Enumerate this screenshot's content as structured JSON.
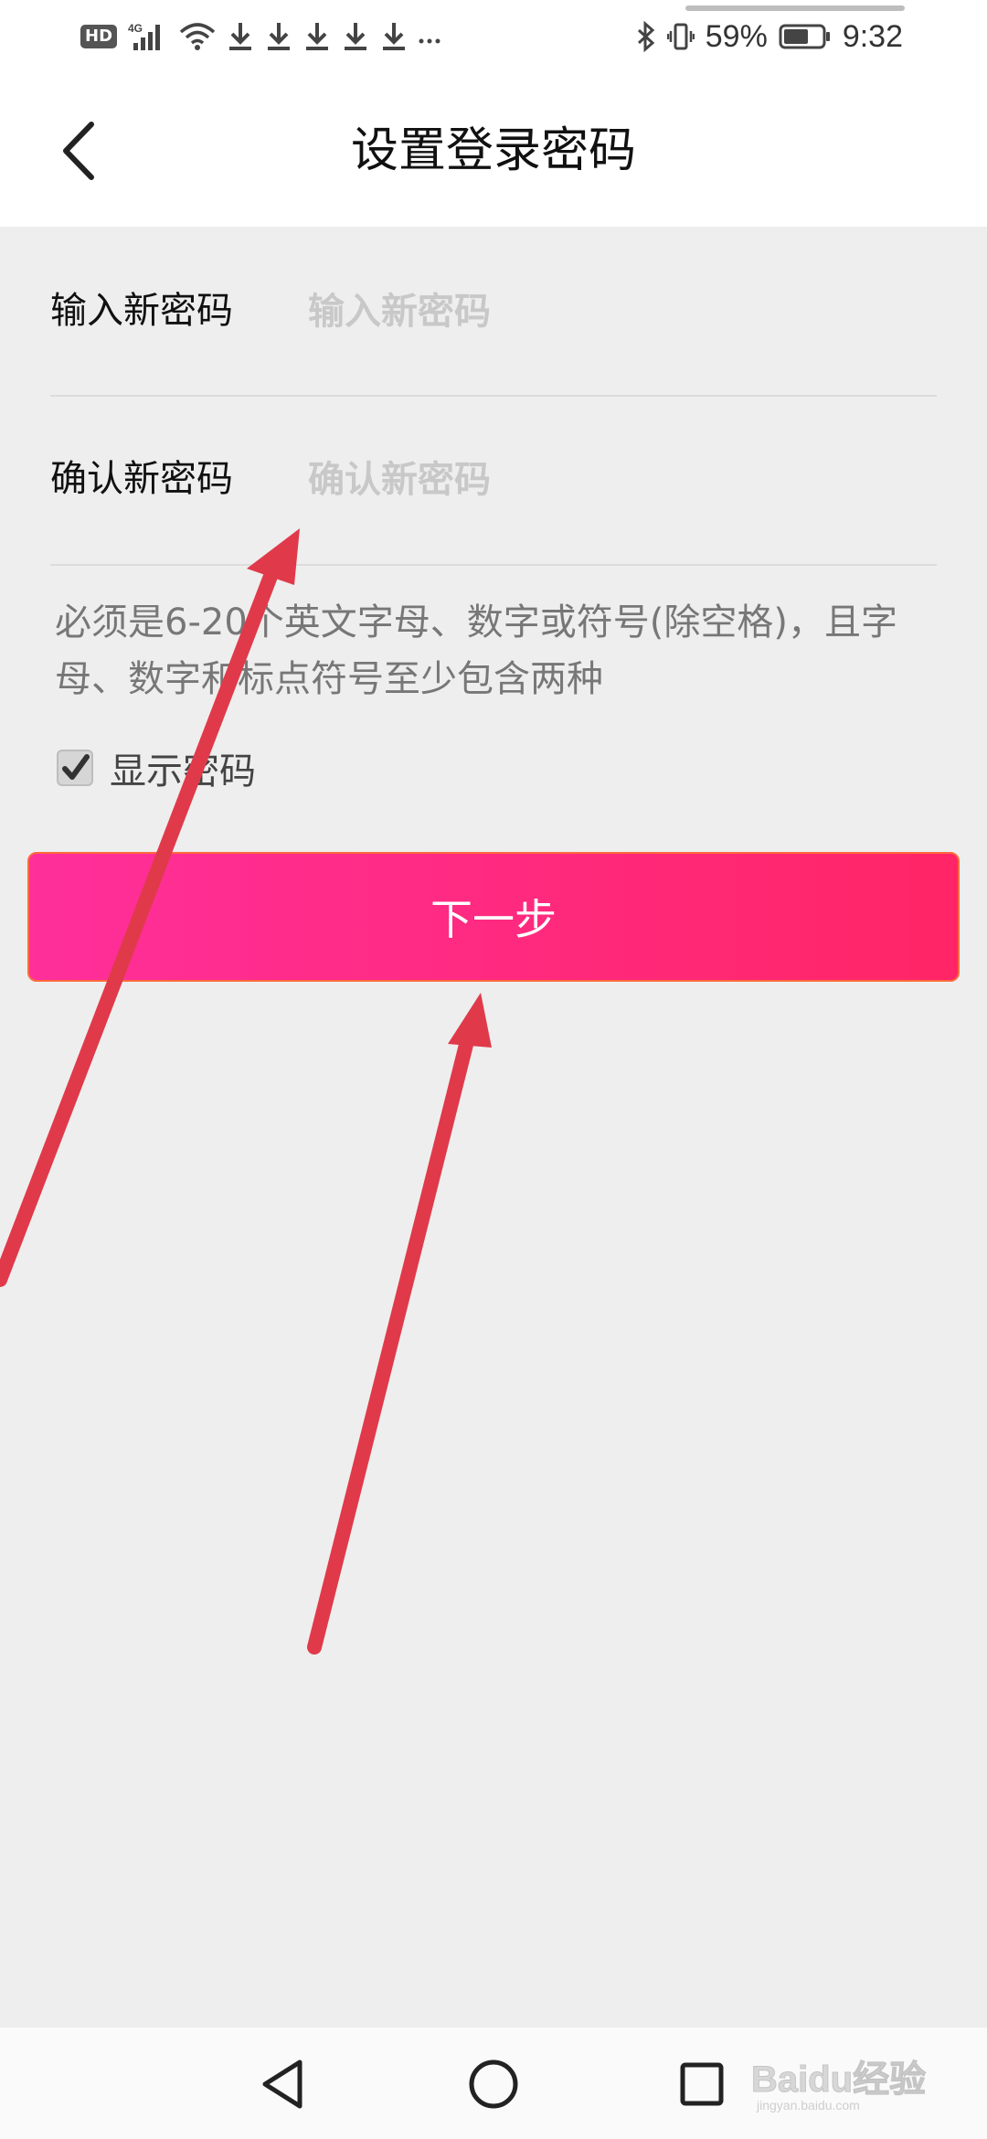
{
  "status_bar": {
    "network_badge": "HD",
    "network_type": "4G",
    "battery_percent": "59%",
    "time": "9:32",
    "icons": [
      "signal-icon",
      "wifi-icon",
      "download-icon",
      "download-icon",
      "download-icon",
      "download-icon",
      "download-icon",
      "more-icon",
      "bluetooth-icon",
      "vibrate-icon",
      "battery-icon"
    ]
  },
  "header": {
    "title": "设置登录密码",
    "back_icon": "chevron-left-icon"
  },
  "form": {
    "new_password": {
      "label": "输入新密码",
      "placeholder": "输入新密码",
      "value": ""
    },
    "confirm_password": {
      "label": "确认新密码",
      "placeholder": "确认新密码",
      "value": ""
    },
    "hint": "必须是6-20个英文字母、数字或符号(除空格)，且字母、数字和标点符号至少包含两种",
    "show_password": {
      "label": "显示密码",
      "checked": true
    }
  },
  "actions": {
    "next_label": "下一步"
  },
  "annotations": {
    "arrow_color": "#e03a4a",
    "count": 2
  },
  "nav_bar": {
    "icons": [
      "nav-back-icon",
      "nav-home-icon",
      "nav-recent-icon"
    ]
  },
  "watermark": {
    "text": "Baidu经验",
    "subtext": "jingyan.baidu.com"
  },
  "colors": {
    "accent_start": "#ff2f9b",
    "accent_end": "#ff2566",
    "background": "#eeeeee"
  }
}
